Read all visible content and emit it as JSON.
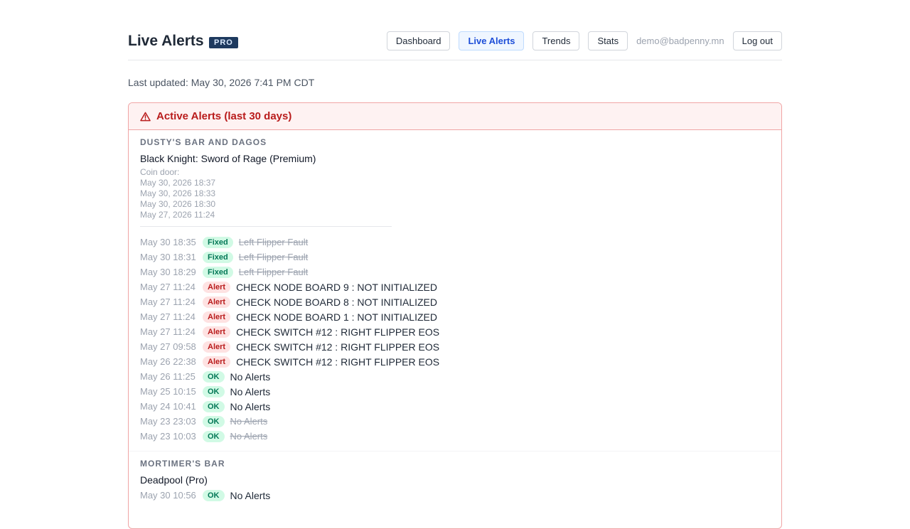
{
  "header": {
    "title": "Live Alerts",
    "badge": "PRO",
    "nav": {
      "dashboard": "Dashboard",
      "live_alerts": "Live Alerts",
      "trends": "Trends",
      "stats": "Stats",
      "email": "demo@badpenny.mn",
      "logout": "Log out"
    }
  },
  "last_updated": "Last updated: May 30, 2026 7:41 PM CDT",
  "panel": {
    "title": "Active Alerts (last 30 days)",
    "icon": "warning-triangle-icon",
    "accent": "#b91c1c"
  },
  "locations": [
    {
      "name": "DUSTY'S BAR AND DAGOS",
      "machine": "Black Knight: Sword of Rage (Premium)",
      "coin_door": [
        "Coin door:",
        "May 30, 2026 18:37",
        "May 30, 2026 18:33",
        "May 30, 2026 18:30",
        "May 27, 2026 11:24"
      ],
      "events": [
        {
          "date": "May 30 18:35",
          "status": "Fixed",
          "message": "Left Flipper Fault",
          "struck": true
        },
        {
          "date": "May 30 18:31",
          "status": "Fixed",
          "message": "Left Flipper Fault",
          "struck": true
        },
        {
          "date": "May 30 18:29",
          "status": "Fixed",
          "message": "Left Flipper Fault",
          "struck": true
        },
        {
          "date": "May 27 11:24",
          "status": "Alert",
          "message": "CHECK NODE BOARD 9 : NOT INITIALIZED",
          "struck": false
        },
        {
          "date": "May 27 11:24",
          "status": "Alert",
          "message": "CHECK NODE BOARD 8 : NOT INITIALIZED",
          "struck": false
        },
        {
          "date": "May 27 11:24",
          "status": "Alert",
          "message": "CHECK NODE BOARD 1 : NOT INITIALIZED",
          "struck": false
        },
        {
          "date": "May 27 11:24",
          "status": "Alert",
          "message": "CHECK SWITCH #12 : RIGHT FLIPPER EOS",
          "struck": false
        },
        {
          "date": "May 27 09:58",
          "status": "Alert",
          "message": "CHECK SWITCH #12 : RIGHT FLIPPER EOS",
          "struck": false
        },
        {
          "date": "May 26 22:38",
          "status": "Alert",
          "message": "CHECK SWITCH #12 : RIGHT FLIPPER EOS",
          "struck": false
        },
        {
          "date": "May 26 11:25",
          "status": "OK",
          "message": "No Alerts",
          "struck": false
        },
        {
          "date": "May 25 10:15",
          "status": "OK",
          "message": "No Alerts",
          "struck": false
        },
        {
          "date": "May 24 10:41",
          "status": "OK",
          "message": "No Alerts",
          "struck": false
        },
        {
          "date": "May 23 23:03",
          "status": "OK",
          "message": "No Alerts",
          "struck": true
        },
        {
          "date": "May 23 10:03",
          "status": "OK",
          "message": "No Alerts",
          "struck": true
        }
      ]
    },
    {
      "name": "MORTIMER'S BAR",
      "machine": "Deadpool (Pro)",
      "coin_door": [],
      "events": [
        {
          "date": "May 30 10:56",
          "status": "OK",
          "message": "No Alerts",
          "struck": false
        }
      ]
    }
  ]
}
